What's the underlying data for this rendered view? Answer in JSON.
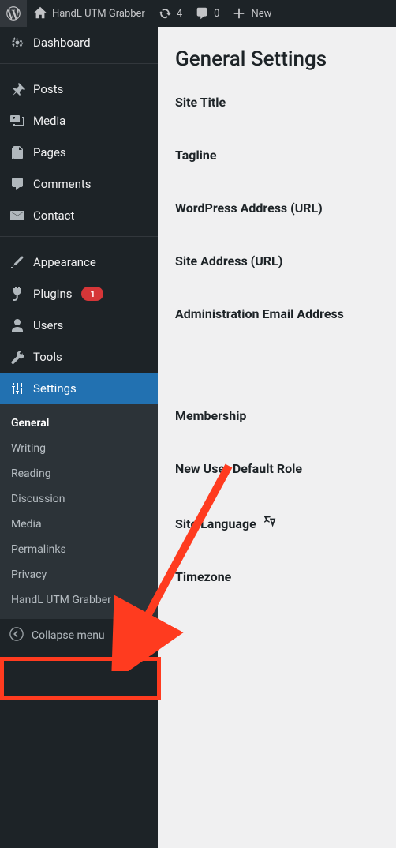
{
  "admin_bar": {
    "site_name": "HandL UTM Grabber",
    "updates_count": "4",
    "comments_count": "0",
    "new_label": "New"
  },
  "menu": {
    "dashboard": "Dashboard",
    "posts": "Posts",
    "media": "Media",
    "pages": "Pages",
    "comments": "Comments",
    "contact": "Contact",
    "appearance": "Appearance",
    "plugins": "Plugins",
    "plugins_badge": "1",
    "users": "Users",
    "tools": "Tools",
    "settings": "Settings",
    "collapse": "Collapse menu"
  },
  "settings_submenu": {
    "general": "General",
    "writing": "Writing",
    "reading": "Reading",
    "discussion": "Discussion",
    "media": "Media",
    "permalinks": "Permalinks",
    "privacy": "Privacy",
    "handl": "HandL UTM Grabber"
  },
  "content": {
    "heading": "General Settings",
    "site_title": "Site Title",
    "tagline": "Tagline",
    "wp_address": "WordPress Address (URL)",
    "site_address": "Site Address (URL)",
    "admin_email": "Administration Email Address",
    "membership": "Membership",
    "new_user_role": "New User Default Role",
    "site_language": "Site Language",
    "timezone": "Timezone"
  }
}
